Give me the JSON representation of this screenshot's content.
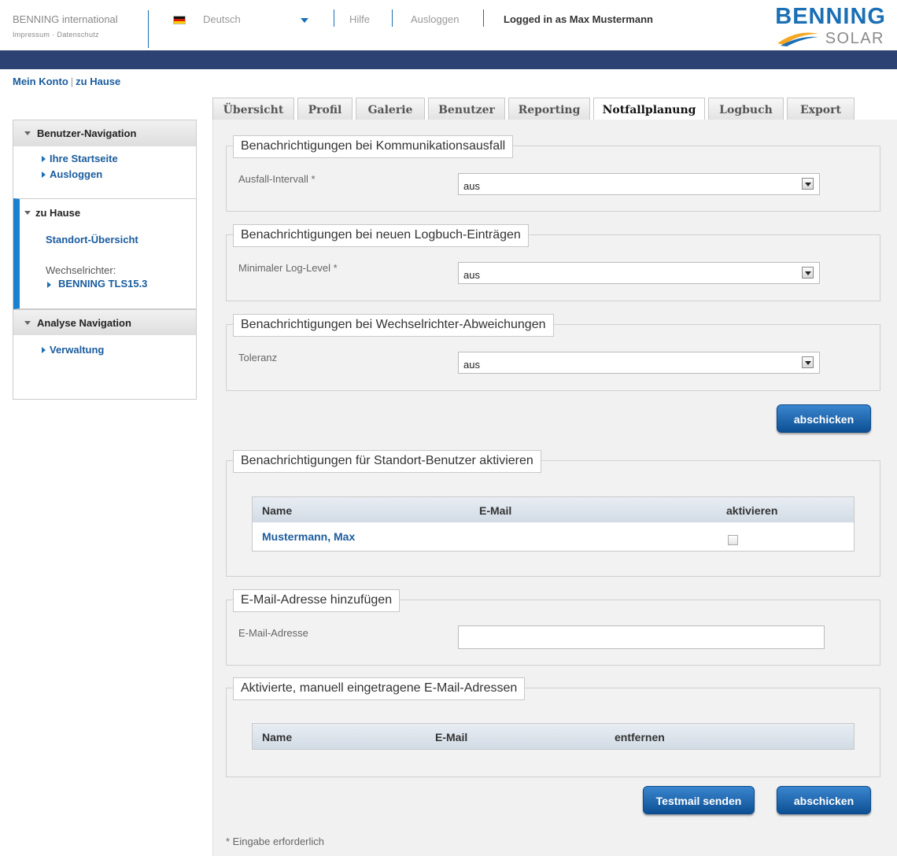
{
  "header": {
    "brand_name": "BENNING international",
    "impressum_link": "Impressum",
    "link_separator": "·",
    "datenschutz_link": "Datenschutz",
    "language": "Deutsch",
    "help_link": "Hilfe",
    "logout_link": "Ausloggen",
    "logged_in_text": "Logged in as Max Mustermann",
    "logo_title": "BENNING",
    "logo_subtitle": "SOLAR"
  },
  "colors": {
    "brand_blue": "#1a6fb5",
    "top_bar": "#2c4272",
    "button": "#0d4f93",
    "active_nav_marker": "#1a80d0"
  },
  "breadcrumb": {
    "items": [
      "Mein Konto",
      "zu Hause"
    ],
    "separator": "|"
  },
  "sidebar": {
    "user_nav": {
      "title": "Benutzer-Navigation",
      "items": [
        "Ihre Startseite",
        "Ausloggen"
      ]
    },
    "home": {
      "title": "zu Hause",
      "location_link": "Standort-Übersicht",
      "inverter_label": "Wechselrichter:",
      "inverter_item": "BENNING TLS15.3"
    },
    "analysis_nav": {
      "title": "Analyse Navigation",
      "items": [
        "Verwaltung"
      ]
    }
  },
  "tabs": [
    "Übersicht",
    "Profil",
    "Galerie",
    "Benutzer",
    "Reporting",
    "Notfallplanung",
    "Logbuch",
    "Export"
  ],
  "active_tab": "Notfallplanung",
  "sections": {
    "comm_failure": {
      "legend": "Benachrichtigungen bei Kommunikationsausfall",
      "field_label": "Ausfall-Intervall *",
      "value": "aus"
    },
    "log_entries": {
      "legend": "Benachrichtigungen bei neuen Logbuch-Einträgen",
      "field_label": "Minimaler Log-Level *",
      "value": "aus"
    },
    "inverter_deviation": {
      "legend": "Benachrichtigungen bei Wechselrichter-Abweichungen",
      "field_label": "Toleranz",
      "value": "aus"
    },
    "site_users": {
      "legend": "Benachrichtigungen für Standort-Benutzer aktivieren",
      "columns": [
        "Name",
        "E-Mail",
        "aktivieren"
      ],
      "rows": [
        {
          "name": "Mustermann, Max",
          "email": "",
          "activated": false
        }
      ]
    },
    "add_email": {
      "legend": "E-Mail-Adresse hinzufügen",
      "field_label": "E-Mail-Adresse",
      "value": "",
      "placeholder": ""
    },
    "manual_emails": {
      "legend": "Aktivierte, manuell eingetragene E-Mail-Adressen",
      "columns": [
        "Name",
        "E-Mail",
        "entfernen"
      ],
      "rows": []
    }
  },
  "buttons": {
    "submit_top": "abschicken",
    "testmail": "Testmail senden",
    "submit_bottom": "abschicken"
  },
  "required_note": "* Eingabe erforderlich"
}
